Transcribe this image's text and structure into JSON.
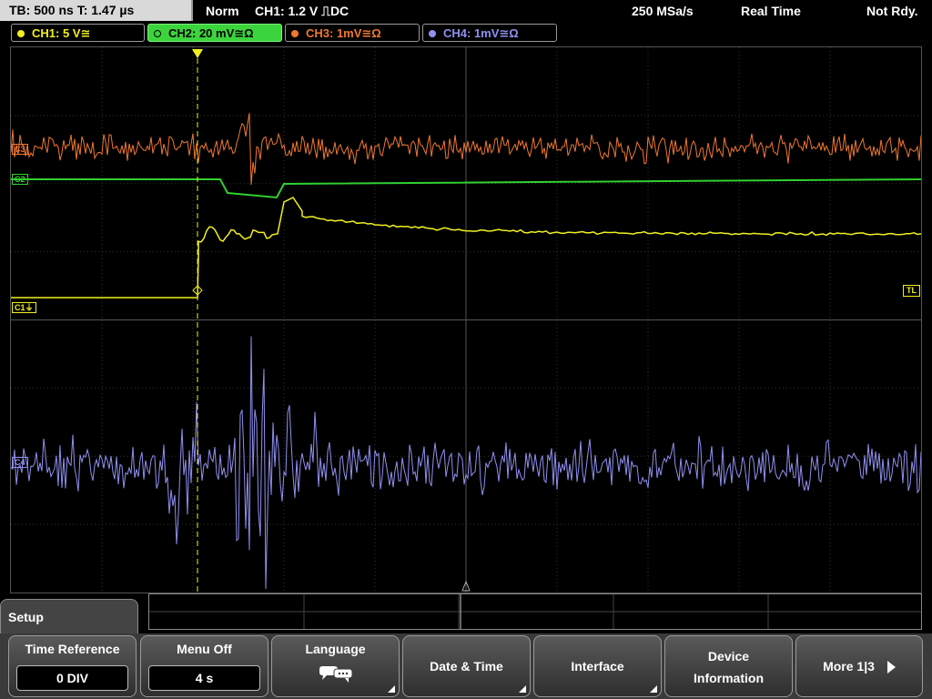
{
  "status_bar": {
    "timebase": "TB: 500 ns   T: 1.47 µs",
    "trigger_mode": "Norm",
    "trigger_info": "CH1: 1.2 V ⎍DC",
    "sample_rate": "250 MSa/s",
    "acq_mode": "Real Time",
    "acq_state": "Not Rdy."
  },
  "channels": [
    {
      "label": "CH1: 5 V≅",
      "color": "#f0f020",
      "active": false
    },
    {
      "label": "CH2: 20 mV≅Ω",
      "color": "#30d030",
      "active": true
    },
    {
      "label": "CH3: 1mV≅Ω",
      "color": "#f07830",
      "active": false
    },
    {
      "label": "CH4: 1mV≅Ω",
      "color": "#9090f0",
      "active": false
    }
  ],
  "markers": {
    "c1": "C1⏚",
    "c2": "C2",
    "c3": "C3",
    "c4": "C4",
    "trigger_level": "TL"
  },
  "menu": {
    "title": "Setup",
    "softkeys": [
      {
        "title": "Time Reference",
        "value": "0 DIV"
      },
      {
        "title": "Menu Off",
        "value": "4 s"
      },
      {
        "title": "Language",
        "icon": "speech-bubbles-icon"
      },
      {
        "title": "Date & Time"
      },
      {
        "title": "Interface"
      },
      {
        "title": "Device\nInformation",
        "line1": "Device",
        "line2": "Information"
      },
      {
        "title": "More 1|3"
      }
    ]
  },
  "colors": {
    "ch1": "#f0f020",
    "ch2": "#30d030",
    "ch3": "#f07830",
    "ch4": "#9090f0",
    "grid": "#3a3a3a"
  }
}
